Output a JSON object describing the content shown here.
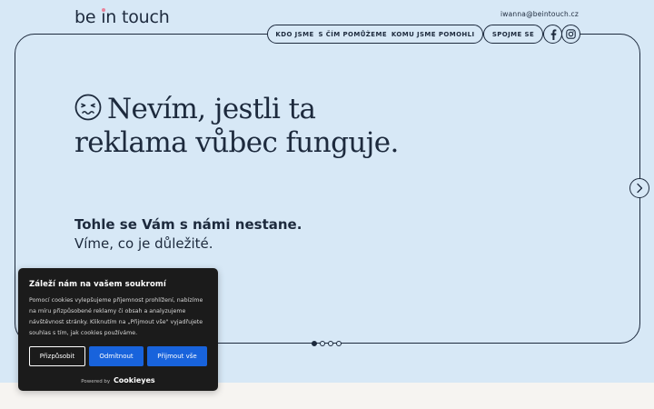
{
  "header": {
    "logo": "be in touch",
    "email": "iwanna@beintouch.cz",
    "nav": [
      "KDO JSME",
      "S ČÍM POMŮŽEME",
      "KOMU JSME POMOHLI"
    ],
    "contact_label": "SPOJME SE",
    "social_icons": [
      "facebook-icon",
      "instagram-icon"
    ]
  },
  "hero": {
    "headline_line1": "Nevím, jestli ta",
    "headline_line2": "reklama vůbec funguje.",
    "emoji_icon": "worried-face-icon",
    "sub_strong": "Tohle se Vám s námi nestane.",
    "sub_normal": "Víme, co je důležité.",
    "slides": 4,
    "active_slide": 1
  },
  "cookie_banner": {
    "title": "Záleží nám na vašem soukromí",
    "text": "Pomocí cookies vylepšujeme příjemnost prohlížení, nabízíme na míru přizpůsobené reklamy či obsah a analyzujeme návštěvnost stránky. Kliknutím na „Přijmout vše\" vyjadřujete souhlas s tím, jak cookies používáme.",
    "btn_customize": "Přizpůsobit",
    "btn_reject": "Odmítnout",
    "btn_accept": "Přijmout vše",
    "powered_by": "Powered by",
    "brand": "Cookieyes"
  },
  "colors": {
    "background": "#d7e8f6",
    "ink": "#1d2a3d",
    "accent_dot": "#e9829b",
    "cookie_bg": "#1b1b1b",
    "cookie_button": "#1863dc"
  }
}
